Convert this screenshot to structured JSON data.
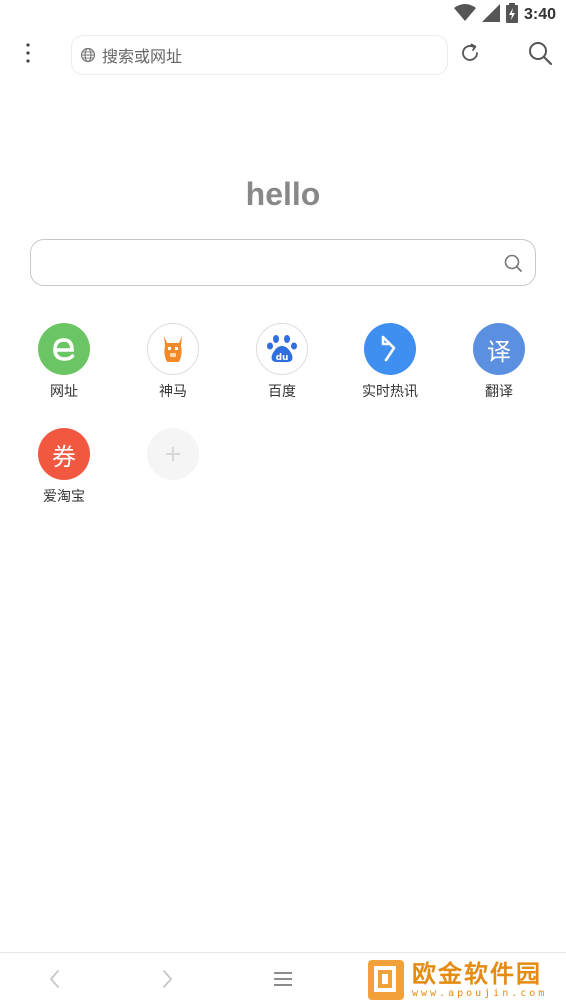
{
  "status_bar": {
    "time": "3:40"
  },
  "address_bar": {
    "placeholder": "搜索或网址"
  },
  "hello": {
    "title": "hello"
  },
  "main_search": {
    "value": ""
  },
  "shortcuts": [
    {
      "label": "网址",
      "color": "#6cc565",
      "icon": "e-browser-icon"
    },
    {
      "label": "神马",
      "color": "#ffffff",
      "icon": "shenma-alpaca-icon"
    },
    {
      "label": "百度",
      "color": "#ffffff",
      "icon": "baidu-paw-icon"
    },
    {
      "label": "实时热讯",
      "color": "#3f8ff0",
      "icon": "arrow-news-icon",
      "glyph": ""
    },
    {
      "label": "翻译",
      "color": "#5b8fe0",
      "icon": "translate-icon",
      "glyph": "译"
    },
    {
      "label": "爱淘宝",
      "color": "#f1583f",
      "icon": "coupon-icon",
      "glyph": "券"
    },
    {
      "label": "",
      "color": "#f5f5f5",
      "icon": "add-icon"
    }
  ],
  "watermark": {
    "text": "欧金软件园",
    "sub": "www.apoujin.com"
  }
}
